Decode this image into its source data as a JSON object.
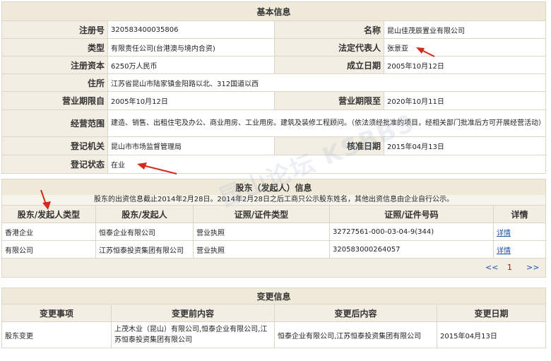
{
  "basic": {
    "title": "基本信息",
    "reg_no_label": "注册号",
    "reg_no": "320583400035806",
    "name_label": "名称",
    "name": "昆山佳茂辰置业有限公司",
    "type_label": "类型",
    "type": "有限责任公司(台港澳与境内合资)",
    "legal_rep_label": "法定代表人",
    "legal_rep": "张景亚",
    "capital_label": "注册资本",
    "capital": "6250万人民币",
    "est_date_label": "成立日期",
    "est_date": "2005年10月12日",
    "address_label": "住所",
    "address": "江苏省昆山市陆家镇金阳路以北、312国道以西",
    "term_from_label": "营业期限自",
    "term_from": "2005年10月12日",
    "term_to_label": "营业期限至",
    "term_to": "2020年10月11日",
    "scope_label": "经营范围",
    "scope": "建造、销售、出租住宅及办公、商业用房、工业用房。建筑及装修工程顾问。（依法须经批准的项目，经相关部门批准后方可开展经营活动）",
    "authority_label": "登记机关",
    "authority": "昆山市市场监督管理局",
    "approve_date_label": "核准日期",
    "approve_date": "2015年04月13日",
    "status_label": "登记状态",
    "status": "在业"
  },
  "shareholders": {
    "title": "股东（发起人）信息",
    "note": "股东的出资信息截止2014年2月28日。2014年2月28日之后工商只公示股东姓名，其他出资信息由企业自行公示。",
    "headers": [
      "股东/发起人类型",
      "股东/发起人",
      "证照/证件类型",
      "证照/证件号码",
      "详情"
    ],
    "rows": [
      {
        "type": "香港企业",
        "name": "恒泰企业有限公司",
        "id_type": "营业执照",
        "id_no": "32727561-000-03-04-9(344)",
        "detail": "详情"
      },
      {
        "type": "有限公司",
        "name": "江苏恒泰投资集团有限公司",
        "id_type": "营业执照",
        "id_no": "320583000264057",
        "detail": "详情"
      }
    ],
    "pager": {
      "prev": "<<",
      "page": "1",
      "next": ">>"
    }
  },
  "changes": {
    "title": "变更信息",
    "headers": [
      "变更事项",
      "变更前内容",
      "变更后内容",
      "变更日期"
    ],
    "rows": [
      {
        "item": "股东变更",
        "before": "上茂木业（昆山）有限公司,恒泰企业有限公司,江苏恒泰投资集团有限公司",
        "after": "恒泰企业有限公司,江苏恒泰投资集团有限公司",
        "date": "2015年04月13日"
      }
    ]
  },
  "watermark": "昆山论坛 KSBBS",
  "colors": {
    "header_bg": "#efe9da",
    "label_bg": "#f2eee3",
    "arrow": "#d42a1c",
    "link": "#1a4fa8"
  }
}
